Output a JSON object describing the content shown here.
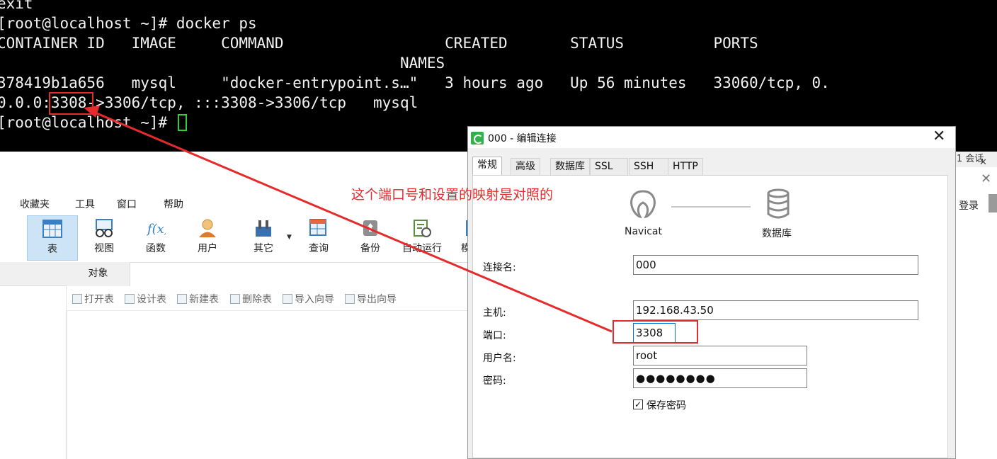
{
  "terminal": {
    "lines": [
      "exit",
      "[root@localhost ~]# docker ps",
      "CONTAINER ID   IMAGE     COMMAND                  CREATED       STATUS          PORTS",
      "                                             NAMES",
      "378419b1a656   mysql     \"docker-entrypoint.s…\"   3 hours ago   Up 56 minutes   33060/tcp, 0.",
      "0.0.0:3308->3306/tcp, :::3308->3306/tcp   mysql",
      "[root@localhost ~]# "
    ]
  },
  "navicat": {
    "menu": [
      "收藏夹",
      "工具",
      "窗口",
      "帮助"
    ],
    "ribbon": [
      "表",
      "视图",
      "函数",
      "用户",
      "其它",
      "查询",
      "备份",
      "自动运行",
      "模"
    ],
    "object_tab": "对象",
    "object_actions": [
      "打开表",
      "设计表",
      "新建表",
      "删除表",
      "导入向导",
      "导出向导"
    ],
    "session_text": "1 会话",
    "login": "登录",
    "close_glyph": "✕"
  },
  "dialog": {
    "title": "000 - 编辑连接",
    "close": "✕",
    "tabs": [
      "常规",
      "高级",
      "数据库",
      "SSL",
      "SSH",
      "HTTP"
    ],
    "left_icon_label": "Navicat",
    "right_icon_label": "数据库",
    "labels": {
      "conn_name": "连接名:",
      "host": "主机:",
      "port": "端口:",
      "user": "用户名:",
      "password": "密码:"
    },
    "values": {
      "conn_name": "000",
      "host": "192.168.43.50",
      "port": "3308",
      "user": "root",
      "password": "●●●●●●●●"
    },
    "save_password": "保存密码",
    "save_password_checked": "✓"
  },
  "annotation": {
    "note": "这个端口号和设置的映射是对照的",
    "color": "#e52b2b"
  }
}
